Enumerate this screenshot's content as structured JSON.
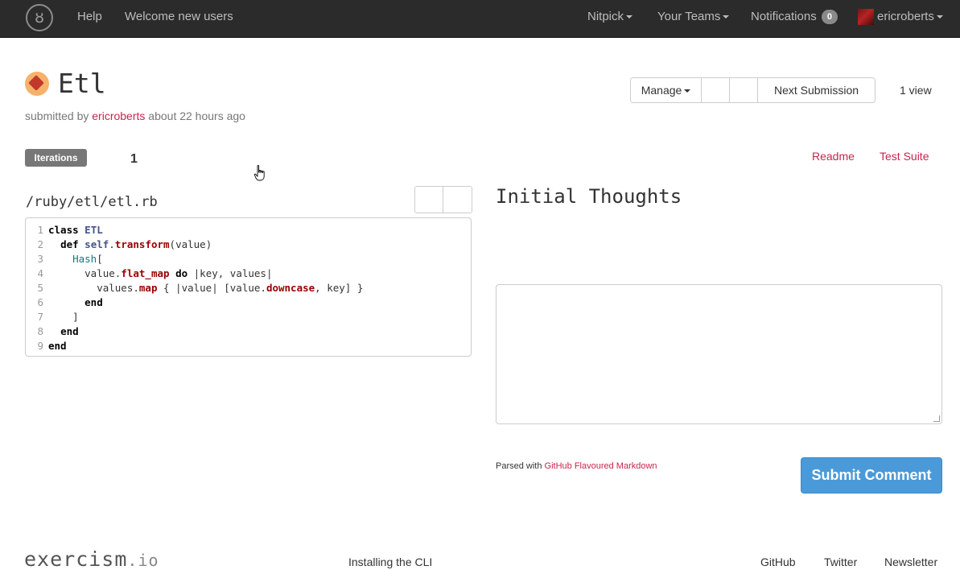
{
  "navbar": {
    "logo_glyph": "ȣ",
    "help": "Help",
    "welcome": "Welcome new users",
    "nitpick": "Nitpick",
    "your_teams": "Your Teams",
    "notifications": "Notifications",
    "notifications_count": "0",
    "username": "ericroberts"
  },
  "header": {
    "title": "Etl",
    "submitted_by_prefix": "submitted by",
    "author": "ericroberts",
    "time_ago": "about 22 hours ago",
    "manage_label": "Manage",
    "next_submission_label": "Next Submission",
    "views_text": "1 view"
  },
  "iterations": {
    "label": "Iterations",
    "current": "1"
  },
  "links": {
    "readme": "Readme",
    "test_suite": "Test Suite"
  },
  "code": {
    "file_path": "/ruby/etl/etl.rb",
    "lines": [
      "class ETL",
      "  def self.transform(value)",
      "    Hash[",
      "      value.flat_map do |key, values|",
      "        values.map { |value| [value.downcase, key] }",
      "      end",
      "    ]",
      "  end",
      "end"
    ]
  },
  "comment": {
    "heading": "Initial Thoughts",
    "parsed_prefix": "Parsed with",
    "parsed_link": "GitHub Flavoured Markdown",
    "submit_label": "Submit Comment"
  },
  "footer": {
    "logo_main": "exercism",
    "logo_suffix": ".io",
    "installing_cli": "Installing the CLI",
    "github": "GitHub",
    "twitter": "Twitter",
    "newsletter": "Newsletter"
  },
  "colors": {
    "navbar_bg": "#2b2b2b",
    "link_red": "#c7254e",
    "submit_blue": "#4a9ad9",
    "badge_gray": "#777777"
  }
}
